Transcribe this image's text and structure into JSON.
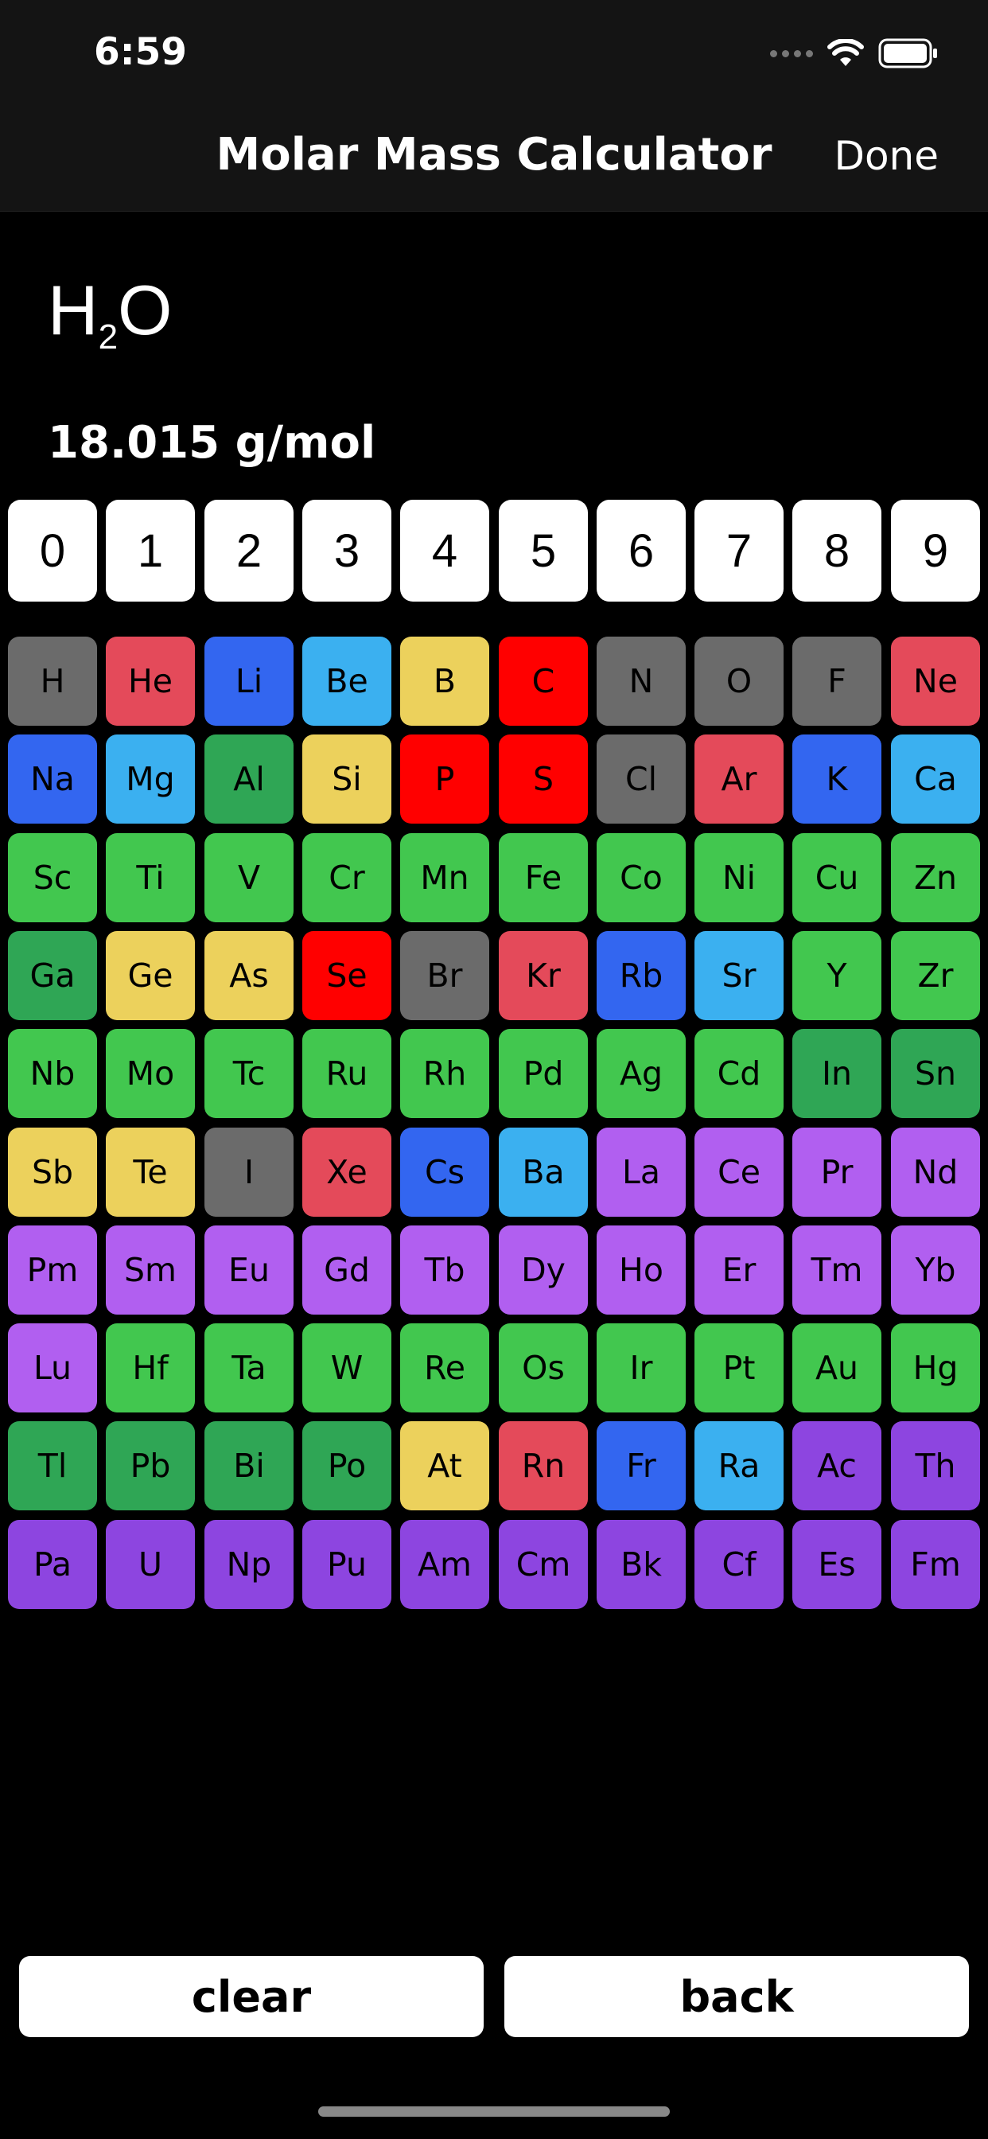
{
  "status": {
    "time": "6:59"
  },
  "nav": {
    "title": "Molar Mass Calculator",
    "done": "Done"
  },
  "formula": {
    "part1": "H",
    "sub": "2",
    "part2": "O"
  },
  "mass": "18.015 g/mol",
  "digits": [
    "0",
    "1",
    "2",
    "3",
    "4",
    "5",
    "6",
    "7",
    "8",
    "9"
  ],
  "palette": {
    "gray": "#6b6b6b",
    "red_pink": "#e44a5a",
    "blue": "#3366f0",
    "light_blue": "#3bb0f0",
    "yellow": "#ecd15c",
    "red": "#ff0000",
    "green": "#42c74f",
    "dark_green": "#2fa655",
    "purple": "#b15ff0",
    "violet": "#8d45e0"
  },
  "elements": [
    {
      "symbol": "H",
      "color": "#6b6b6b"
    },
    {
      "symbol": "He",
      "color": "#e44a5a"
    },
    {
      "symbol": "Li",
      "color": "#3366f0"
    },
    {
      "symbol": "Be",
      "color": "#3bb0f0"
    },
    {
      "symbol": "B",
      "color": "#ecd15c"
    },
    {
      "symbol": "C",
      "color": "#ff0000"
    },
    {
      "symbol": "N",
      "color": "#6b6b6b"
    },
    {
      "symbol": "O",
      "color": "#6b6b6b"
    },
    {
      "symbol": "F",
      "color": "#6b6b6b"
    },
    {
      "symbol": "Ne",
      "color": "#e44a5a"
    },
    {
      "symbol": "Na",
      "color": "#3366f0"
    },
    {
      "symbol": "Mg",
      "color": "#3bb0f0"
    },
    {
      "symbol": "Al",
      "color": "#2fa655"
    },
    {
      "symbol": "Si",
      "color": "#ecd15c"
    },
    {
      "symbol": "P",
      "color": "#ff0000"
    },
    {
      "symbol": "S",
      "color": "#ff0000"
    },
    {
      "symbol": "Cl",
      "color": "#6b6b6b"
    },
    {
      "symbol": "Ar",
      "color": "#e44a5a"
    },
    {
      "symbol": "K",
      "color": "#3366f0"
    },
    {
      "symbol": "Ca",
      "color": "#3bb0f0"
    },
    {
      "symbol": "Sc",
      "color": "#42c74f"
    },
    {
      "symbol": "Ti",
      "color": "#42c74f"
    },
    {
      "symbol": "V",
      "color": "#42c74f"
    },
    {
      "symbol": "Cr",
      "color": "#42c74f"
    },
    {
      "symbol": "Mn",
      "color": "#42c74f"
    },
    {
      "symbol": "Fe",
      "color": "#42c74f"
    },
    {
      "symbol": "Co",
      "color": "#42c74f"
    },
    {
      "symbol": "Ni",
      "color": "#42c74f"
    },
    {
      "symbol": "Cu",
      "color": "#42c74f"
    },
    {
      "symbol": "Zn",
      "color": "#42c74f"
    },
    {
      "symbol": "Ga",
      "color": "#2fa655"
    },
    {
      "symbol": "Ge",
      "color": "#ecd15c"
    },
    {
      "symbol": "As",
      "color": "#ecd15c"
    },
    {
      "symbol": "Se",
      "color": "#ff0000"
    },
    {
      "symbol": "Br",
      "color": "#6b6b6b"
    },
    {
      "symbol": "Kr",
      "color": "#e44a5a"
    },
    {
      "symbol": "Rb",
      "color": "#3366f0"
    },
    {
      "symbol": "Sr",
      "color": "#3bb0f0"
    },
    {
      "symbol": "Y",
      "color": "#42c74f"
    },
    {
      "symbol": "Zr",
      "color": "#42c74f"
    },
    {
      "symbol": "Nb",
      "color": "#42c74f"
    },
    {
      "symbol": "Mo",
      "color": "#42c74f"
    },
    {
      "symbol": "Tc",
      "color": "#42c74f"
    },
    {
      "symbol": "Ru",
      "color": "#42c74f"
    },
    {
      "symbol": "Rh",
      "color": "#42c74f"
    },
    {
      "symbol": "Pd",
      "color": "#42c74f"
    },
    {
      "symbol": "Ag",
      "color": "#42c74f"
    },
    {
      "symbol": "Cd",
      "color": "#42c74f"
    },
    {
      "symbol": "In",
      "color": "#2fa655"
    },
    {
      "symbol": "Sn",
      "color": "#2fa655"
    },
    {
      "symbol": "Sb",
      "color": "#ecd15c"
    },
    {
      "symbol": "Te",
      "color": "#ecd15c"
    },
    {
      "symbol": "I",
      "color": "#6b6b6b"
    },
    {
      "symbol": "Xe",
      "color": "#e44a5a"
    },
    {
      "symbol": "Cs",
      "color": "#3366f0"
    },
    {
      "symbol": "Ba",
      "color": "#3bb0f0"
    },
    {
      "symbol": "La",
      "color": "#b15ff0"
    },
    {
      "symbol": "Ce",
      "color": "#b15ff0"
    },
    {
      "symbol": "Pr",
      "color": "#b15ff0"
    },
    {
      "symbol": "Nd",
      "color": "#b15ff0"
    },
    {
      "symbol": "Pm",
      "color": "#b15ff0"
    },
    {
      "symbol": "Sm",
      "color": "#b15ff0"
    },
    {
      "symbol": "Eu",
      "color": "#b15ff0"
    },
    {
      "symbol": "Gd",
      "color": "#b15ff0"
    },
    {
      "symbol": "Tb",
      "color": "#b15ff0"
    },
    {
      "symbol": "Dy",
      "color": "#b15ff0"
    },
    {
      "symbol": "Ho",
      "color": "#b15ff0"
    },
    {
      "symbol": "Er",
      "color": "#b15ff0"
    },
    {
      "symbol": "Tm",
      "color": "#b15ff0"
    },
    {
      "symbol": "Yb",
      "color": "#b15ff0"
    },
    {
      "symbol": "Lu",
      "color": "#b15ff0"
    },
    {
      "symbol": "Hf",
      "color": "#42c74f"
    },
    {
      "symbol": "Ta",
      "color": "#42c74f"
    },
    {
      "symbol": "W",
      "color": "#42c74f"
    },
    {
      "symbol": "Re",
      "color": "#42c74f"
    },
    {
      "symbol": "Os",
      "color": "#42c74f"
    },
    {
      "symbol": "Ir",
      "color": "#42c74f"
    },
    {
      "symbol": "Pt",
      "color": "#42c74f"
    },
    {
      "symbol": "Au",
      "color": "#42c74f"
    },
    {
      "symbol": "Hg",
      "color": "#42c74f"
    },
    {
      "symbol": "Tl",
      "color": "#2fa655"
    },
    {
      "symbol": "Pb",
      "color": "#2fa655"
    },
    {
      "symbol": "Bi",
      "color": "#2fa655"
    },
    {
      "symbol": "Po",
      "color": "#2fa655"
    },
    {
      "symbol": "At",
      "color": "#ecd15c"
    },
    {
      "symbol": "Rn",
      "color": "#e44a5a"
    },
    {
      "symbol": "Fr",
      "color": "#3366f0"
    },
    {
      "symbol": "Ra",
      "color": "#3bb0f0"
    },
    {
      "symbol": "Ac",
      "color": "#8d45e0"
    },
    {
      "symbol": "Th",
      "color": "#8d45e0"
    },
    {
      "symbol": "Pa",
      "color": "#8d45e0"
    },
    {
      "symbol": "U",
      "color": "#8d45e0"
    },
    {
      "symbol": "Np",
      "color": "#8d45e0"
    },
    {
      "symbol": "Pu",
      "color": "#8d45e0"
    },
    {
      "symbol": "Am",
      "color": "#8d45e0"
    },
    {
      "symbol": "Cm",
      "color": "#8d45e0"
    },
    {
      "symbol": "Bk",
      "color": "#8d45e0"
    },
    {
      "symbol": "Cf",
      "color": "#8d45e0"
    },
    {
      "symbol": "Es",
      "color": "#8d45e0"
    },
    {
      "symbol": "Fm",
      "color": "#8d45e0"
    }
  ],
  "buttons": {
    "clear": "clear",
    "back": "back"
  }
}
